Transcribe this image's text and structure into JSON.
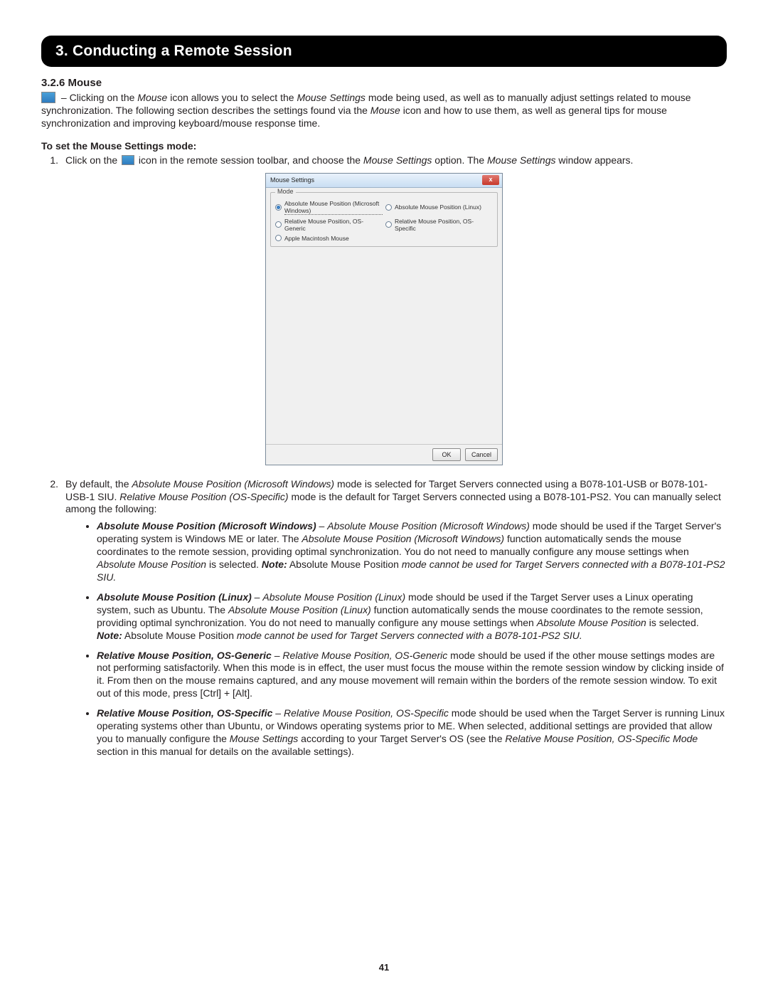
{
  "header": {
    "title": "3. Conducting a Remote Session"
  },
  "section": {
    "heading": "3.2.6 Mouse",
    "intro_prefix": " – Clicking on the ",
    "intro_mouse": "Mouse",
    "intro_mid1": " icon allows you to select the ",
    "intro_ms": "Mouse Settings",
    "intro_mid2": " mode being used, as well as to manually adjust settings related to mouse synchronization. The following section describes the settings found via the ",
    "intro_mouse2": "Mouse",
    "intro_tail": " icon and how to use them, as well as general tips for mouse synchronization and improving keyboard/mouse response time."
  },
  "setmode": {
    "heading": "To set the Mouse Settings mode:",
    "step1_num": "1.",
    "step1_a": "Click on the ",
    "step1_b": " icon in the remote session toolbar, and choose the ",
    "step1_ms": "Mouse Settings",
    "step1_c": " option. The ",
    "step1_msw": "Mouse Settings",
    "step1_d": " window appears.",
    "step2_num": "2.",
    "step2_a": "By default, the ",
    "step2_amp": "Absolute Mouse Position (Microsoft Windows)",
    "step2_b": " mode is selected for Target Servers connected using a B078-101-USB or B078-101-USB-1 SIU. ",
    "step2_rmp": "Relative Mouse Position (OS-Specific)",
    "step2_c": " mode is the default for Target Servers connected using a B078-101-PS2. You can manually select among the following:"
  },
  "bullets": [
    {
      "lead": "Absolute Mouse Position (Microsoft Windows)",
      "dash": " – ",
      "it1": "Absolute Mouse Position (Microsoft Windows)",
      "mid1": " mode should be used if the Target Server's operating system is Windows ME or later. The ",
      "it2": "Absolute Mouse Position (Microsoft Windows)",
      "mid2": " function automatically sends the mouse coordinates to the remote session, providing optimal synchronization. You do not need to manually configure any mouse settings when ",
      "it3": "Absolute Mouse Position",
      "mid3": " is selected. ",
      "noteLabel": "Note:",
      "note_a": " Absolute Mouse Position ",
      "note_it": "mode cannot be used for Target Servers connected with a B078-101-PS2 SIU."
    },
    {
      "lead": "Absolute Mouse Position (Linux)",
      "dash": " – ",
      "it1": "Absolute Mouse Position (Linux)",
      "mid1": " mode should be used if the Target Server uses a Linux operating system, such as Ubuntu. The ",
      "it2": "Absolute Mouse Position (Linux)",
      "mid2": " function automatically sends the mouse coordinates to the remote session, providing optimal synchronization. You do not need to manually configure any mouse settings when ",
      "it3": "Absolute Mouse Position",
      "mid3": " is selected. ",
      "noteLabel": "Note:",
      "note_a": " Absolute Mouse Position ",
      "note_it": "mode cannot be used for Target Servers connected with a B078-101-PS2 SIU."
    },
    {
      "lead": "Relative Mouse Position, OS-Generic",
      "dash": " – ",
      "it1": "Relative Mouse Position, OS-Generic",
      "mid1": " mode should be used if the other mouse settings modes are not performing satisfactorily. When this mode is in effect, the user must focus the mouse within the remote session window by clicking inside of it. From then on the mouse remains captured, and any mouse movement will remain within the borders of the remote session window. To exit out of this mode, press [Ctrl] + [Alt]."
    },
    {
      "lead": "Relative Mouse Position, OS-Specific",
      "dash": " – ",
      "it1": "Relative Mouse Position, OS-Specific",
      "mid1": " mode should be used when the Target Server is running Linux operating systems other than Ubuntu, or Windows operating systems prior to ME. When selected, additional settings are provided that allow you to manually configure the ",
      "it2": "Mouse Settings",
      "mid2": " according to your Target Server's OS (see the ",
      "it3": "Relative Mouse Position, OS-Specific Mode",
      "mid3": " section in this manual for details on the available settings)."
    }
  ],
  "dialog": {
    "title": "Mouse Settings",
    "close": "x",
    "groupLabel": "Mode",
    "radios": [
      {
        "label": "Absolute Mouse Position (Microsoft Windows)",
        "checked": true
      },
      {
        "label": "Absolute Mouse Position (Linux)",
        "checked": false
      },
      {
        "label": "Relative Mouse Position, OS-Generic",
        "checked": false
      },
      {
        "label": "Relative Mouse Position, OS-Specific",
        "checked": false
      },
      {
        "label": "Apple Macintosh Mouse",
        "checked": false
      }
    ],
    "ok": "OK",
    "cancel": "Cancel"
  },
  "page_number": "41"
}
